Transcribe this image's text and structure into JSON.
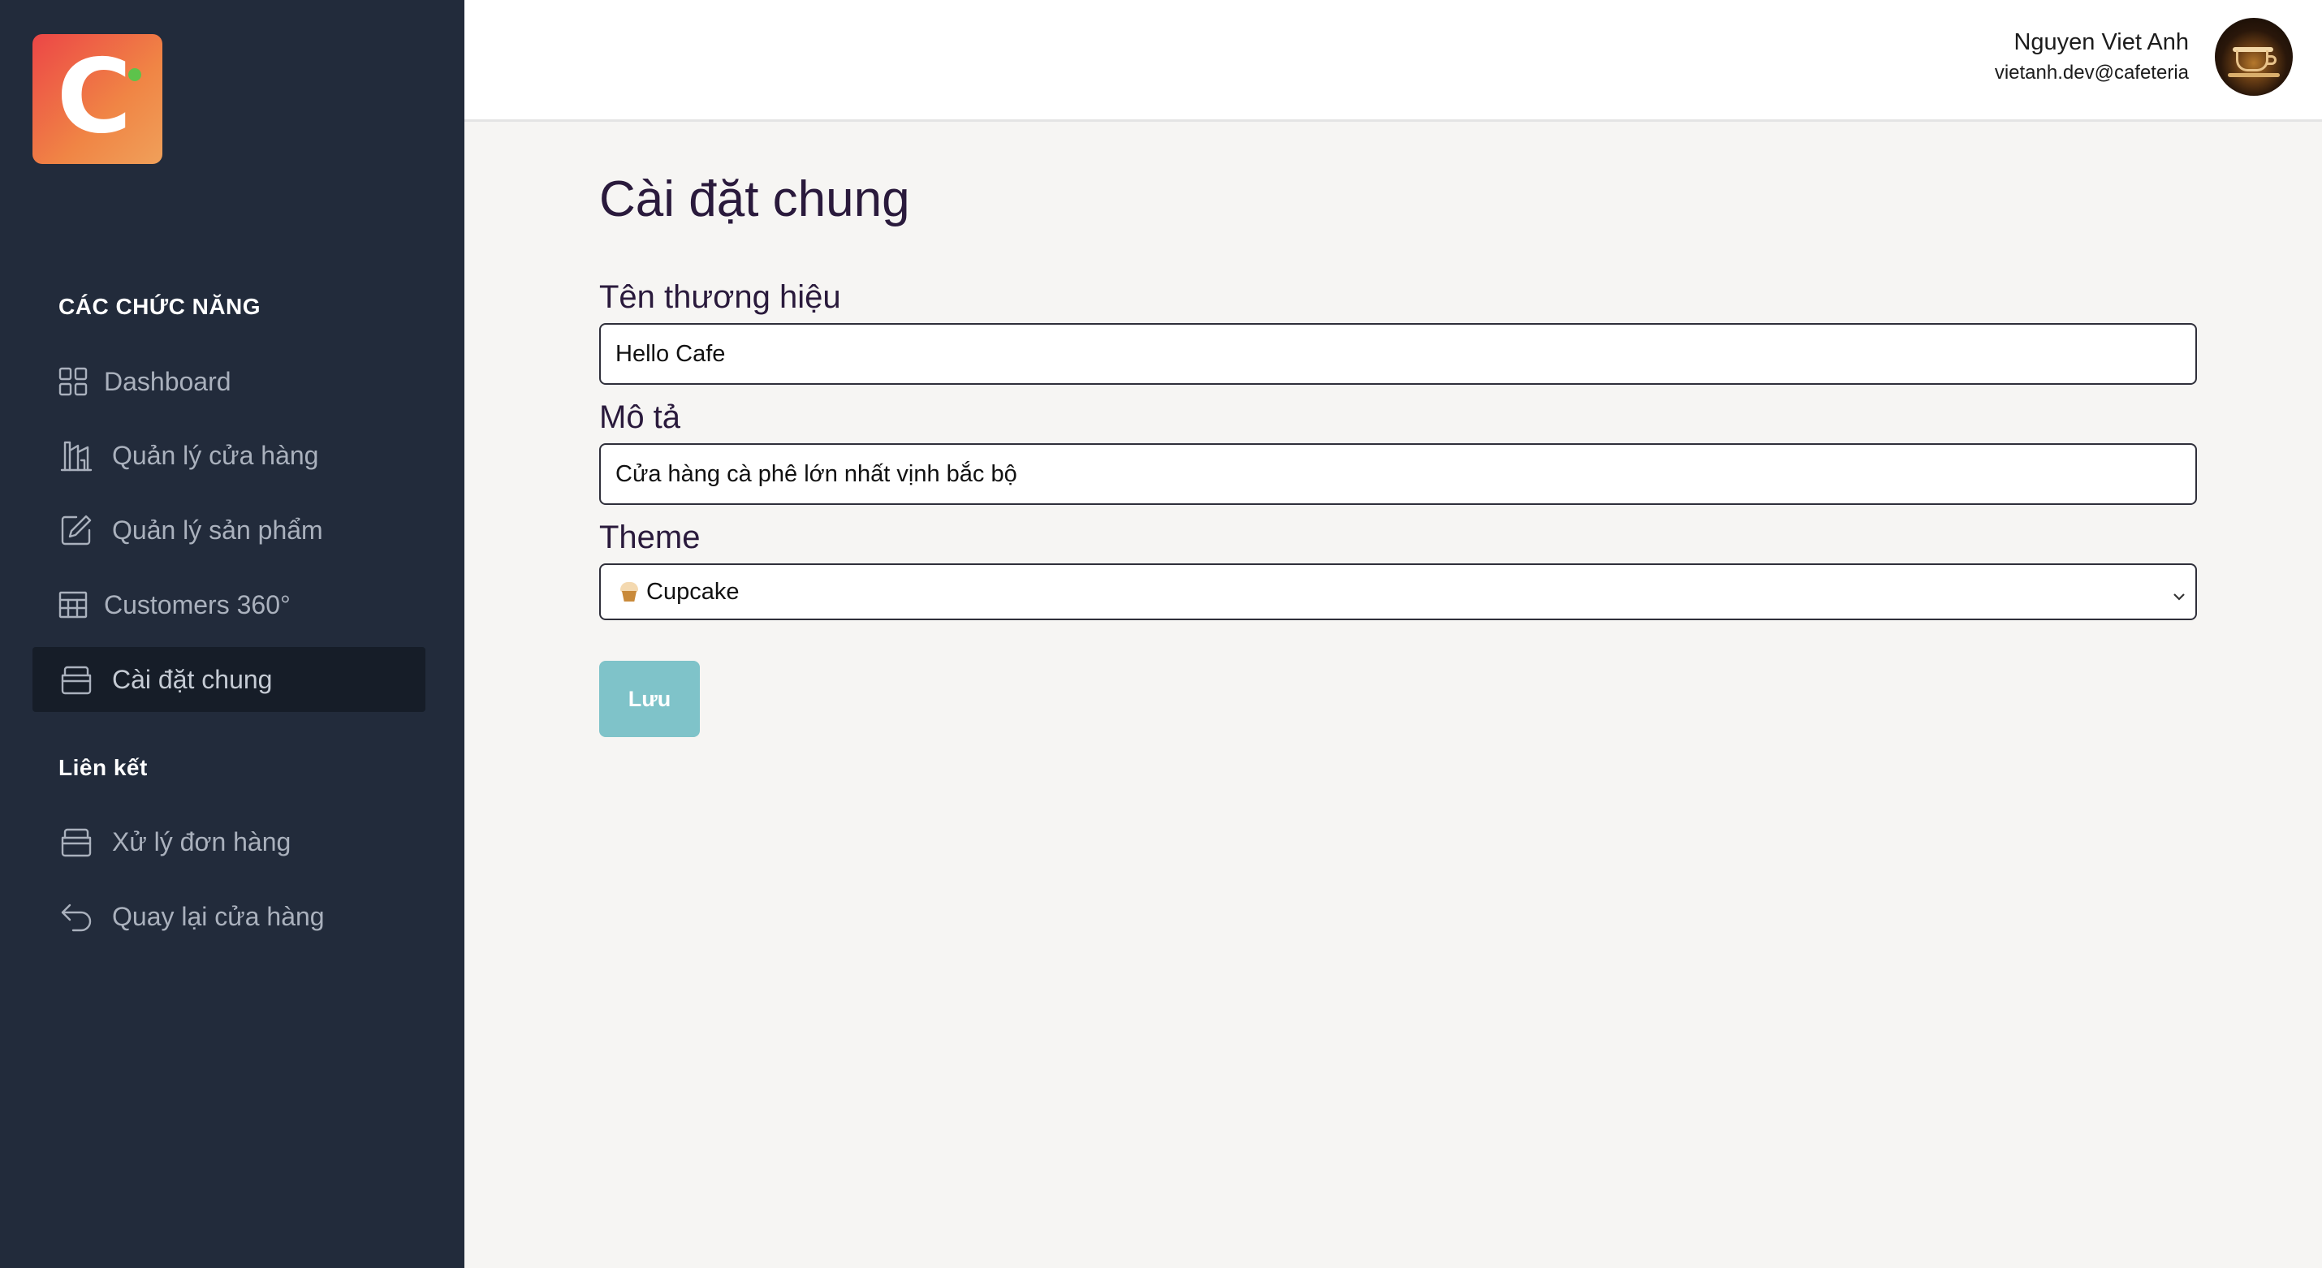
{
  "brand": {
    "logo_letter": "C",
    "logo_colors": [
      "#ec4646",
      "#f0a05a"
    ],
    "status_dot_color": "#5dc34b"
  },
  "sidebar": {
    "section_features": "CÁC CHỨC NĂNG",
    "features": [
      {
        "label": "Dashboard",
        "icon": "grid-icon"
      },
      {
        "label": "Quản lý cửa hàng",
        "icon": "store-icon"
      },
      {
        "label": "Quản lý sản phẩm",
        "icon": "edit-icon"
      },
      {
        "label": "Customers 360°",
        "icon": "table-icon"
      },
      {
        "label": "Cài đặt chung",
        "icon": "archive-icon",
        "active": true
      }
    ],
    "section_links": "Liên kết",
    "links": [
      {
        "label": "Xử lý đơn hàng",
        "icon": "archive-icon"
      },
      {
        "label": "Quay lại cửa hàng",
        "icon": "undo-icon"
      }
    ]
  },
  "header": {
    "user_name": "Nguyen Viet Anh",
    "user_email": "vietanh.dev@cafeteria"
  },
  "main": {
    "title": "Cài đặt chung",
    "brand_name_label": "Tên thương hiệu",
    "brand_name_value": "Hello Cafe",
    "description_label": "Mô tả",
    "description_value": "Cửa hàng cà phê lớn nhất vịnh bắc bộ",
    "theme_label": "Theme",
    "theme_value": "Cupcake",
    "save_label": "Lưu",
    "save_button_color": "#7fc3c9"
  }
}
